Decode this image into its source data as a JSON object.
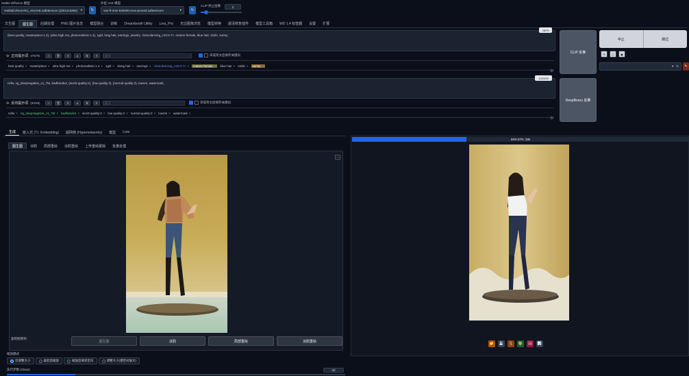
{
  "top": {
    "checkpoint_label": "Stable Diffusion 模型",
    "checkpoint_value": "realisticVisionV51_v51VAE.safetensors [15012c5384]",
    "vae_label": "外挂 VAE 模型",
    "vae_value": "vae-ft-mse-840000-ema-pruned.safetensors",
    "clip_label": "CLIP 终止层数",
    "clip_value": "2",
    "refresh_icon": "refresh-icon"
  },
  "main_tabs": [
    "文生图",
    "图生图",
    "后期处理",
    "PNG 图片信息",
    "模型融合",
    "训练",
    "Dreambooth Utility",
    "Lora_Pro",
    "无边图像浏览",
    "模型转换",
    "超清修复插件",
    "模型工具箱",
    "WD 1.4 标签器",
    "设置",
    "扩展"
  ],
  "active_main_tab": 1,
  "positive": {
    "text": "(best quality, masterpiece:1.2), (ultra high res, photorealistic:1.4), 1girl, long hair, earrings, jewelry, <lora:dancing_v10:0.7>, mature female, blue hair, smile, sunny,",
    "counter": "28/75",
    "label": "正向提示词",
    "count": "275/75",
    "checkbox_label": "译成英文后保存关键词",
    "chips": [
      "best quality",
      "masterpiece",
      "ultra high res",
      "photorealistic:1.4",
      "1girl",
      "1long hair",
      "earrings",
      "<lora:dancing_v10:0.7>",
      "mature female",
      "blue hair",
      "smile",
      "sunny"
    ]
  },
  "negative": {
    "text": "nsfw, ng_deepnegative_v1_75t, badhandv4, (worst quality:2), (low quality:2), (normal quality:2), lowres, watermark,",
    "counter": "102/225",
    "label": "反向提示词",
    "count": "(0/225)",
    "checkbox_label": "译成英文后保存关键词",
    "chips": [
      "nsfw",
      "ng_deepnegative_v1_75t",
      "badhandv4",
      "worst quality:2",
      "low quality:2",
      "normal quality:2",
      "lowres",
      "watermark"
    ]
  },
  "right_panel": {
    "clip_button": "CLIP 反推",
    "deepbooru_button": "DeepBooru 反推",
    "interrupt_button": "中止",
    "skip_button": "跳过"
  },
  "sub_tabs": [
    "生成",
    "嵌入式 (T.I. Embedding)",
    "超网络 (Hypernetworks)",
    "模型",
    "Lora"
  ],
  "active_sub_tab": 0,
  "img_tabs": [
    "图生图",
    "涂鸦",
    "局部重绘",
    "涂鸦重绘",
    "上传重绘蒙版",
    "批量处理"
  ],
  "active_img_tab": 0,
  "copy_label": "复制图像到：",
  "copy_buttons": [
    "图生图",
    "涂鸦",
    "局部重绘",
    "涂鸦重绘"
  ],
  "resize_label": "缩放模式",
  "resize_options": [
    "仅调整大小",
    "裁剪后缩放",
    "缩放后填充空白",
    "调整大小(潜空间放大)"
  ],
  "steps_label": "迭代步数 (Steps)",
  "steps_value": "30",
  "progress": {
    "text": "34% ETA: 33s",
    "fraction": 0.34
  },
  "output_tools": [
    "folder-icon",
    "save-icon",
    "zip-icon",
    "palette-icon",
    "image-icon",
    "chart-icon"
  ],
  "colors": {
    "accent": "#2563eb",
    "background": "#0b0f19",
    "highlight_chip": "#8a6a2a"
  }
}
